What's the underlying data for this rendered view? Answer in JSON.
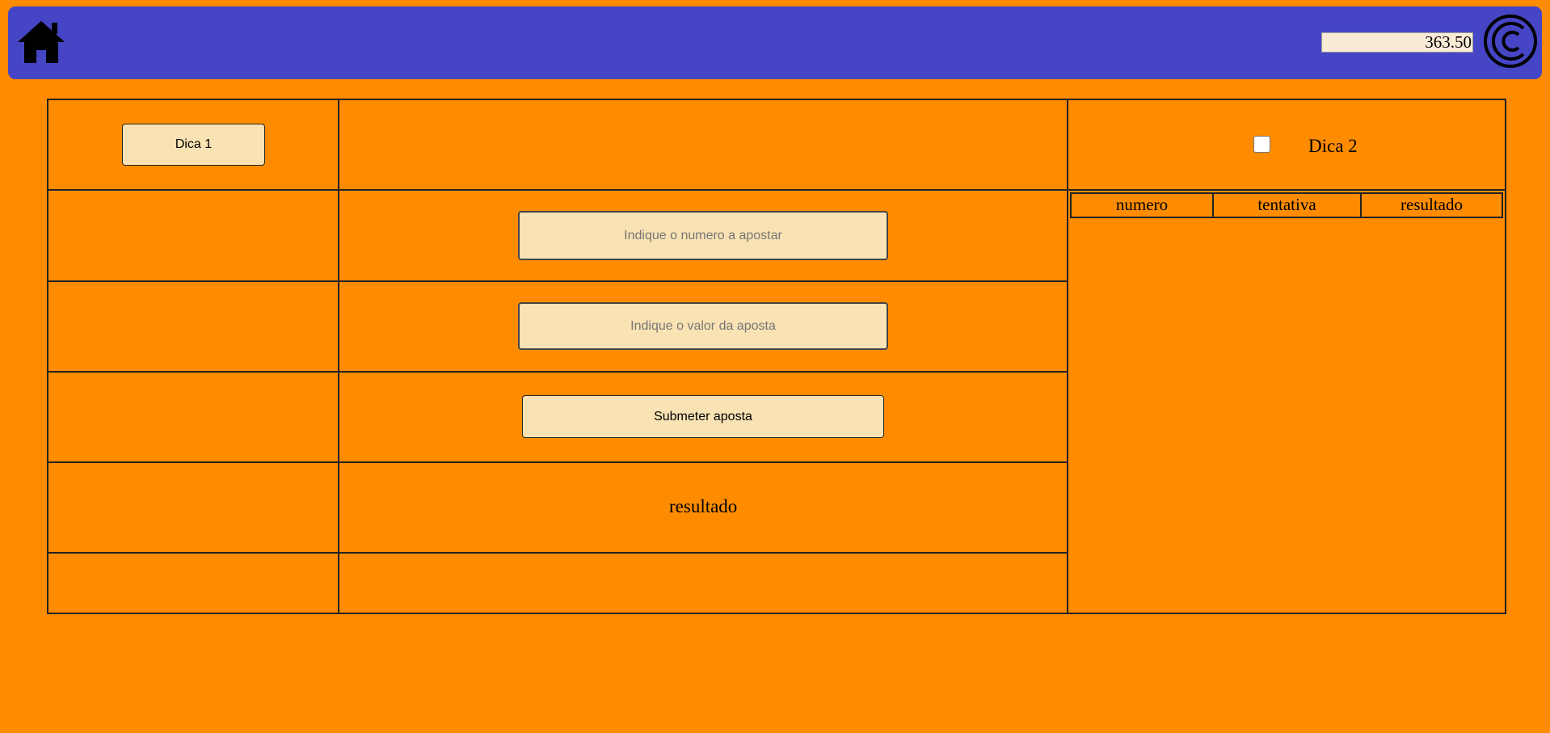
{
  "header": {
    "balance_value": "363.50",
    "home_icon": "home-icon",
    "coin_icon": "coin-icon",
    "accent_color": "#4545c5"
  },
  "hints": {
    "hint1_label": "Dica 1",
    "hint2_label": "Dica 2",
    "hint2_checked": false
  },
  "bet_form": {
    "number_placeholder": "Indique o numero a apostar",
    "number_value": "",
    "amount_placeholder": "Indique o valor da aposta",
    "amount_value": "",
    "submit_label": "Submeter aposta",
    "result_label": "resultado"
  },
  "history": {
    "columns": [
      "numero",
      "tentativa",
      "resultado"
    ],
    "rows": []
  },
  "colors": {
    "page_background": "#ff8c00",
    "control_background": "#f9e2b3"
  }
}
